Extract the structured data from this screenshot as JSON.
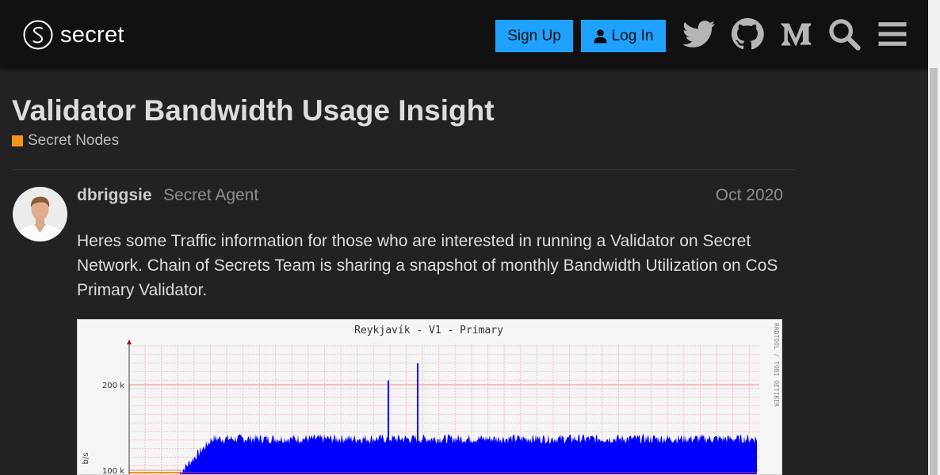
{
  "header": {
    "brand": "secret",
    "signup_label": "Sign Up",
    "login_label": "Log In",
    "icons": [
      "twitter-icon",
      "github-icon",
      "medium-icon",
      "search-icon",
      "hamburger-menu-icon"
    ]
  },
  "topic": {
    "title": "Validator Bandwidth Usage Insight",
    "category": "Secret Nodes",
    "category_color": "#f7941d"
  },
  "post": {
    "username": "dbriggsie",
    "user_title": "Secret Agent",
    "date": "Oct 2020",
    "body": "Heres some Traffic information for those who are interested in running a Validator on Secret Network. Chain of Secrets Team is sharing a snapshot of monthly Bandwidth Utilization on CoS Primary Validator."
  },
  "chart_data": {
    "type": "area",
    "title": "Reykjavík - V1 - Primary",
    "side_label": "RRDTOOL / TOBI OETIKER",
    "ylabel": "b/s",
    "y_ticks": [
      "200 k",
      "100 k"
    ],
    "y_tick_values": [
      200000,
      100000
    ],
    "series": [
      {
        "name": "",
        "color": "#0000ff",
        "baseline_value": 135000,
        "spikes": [
          205000,
          225000
        ]
      },
      {
        "name": "",
        "color": "#ff8c00",
        "value": 95000
      }
    ],
    "grid": true
  }
}
